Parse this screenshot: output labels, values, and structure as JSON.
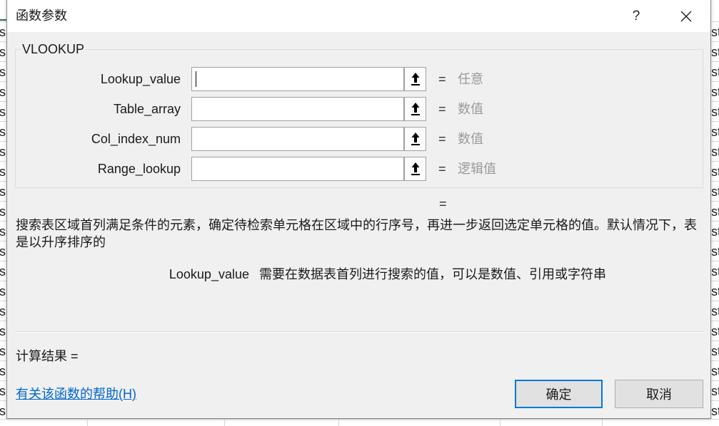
{
  "dialog": {
    "title": "函数参数",
    "help_label": "?",
    "function_name": "VLOOKUP",
    "arguments": [
      {
        "label": "Lookup_value",
        "value": "",
        "equals": "=",
        "result": "任意"
      },
      {
        "label": "Table_array",
        "value": "",
        "equals": "=",
        "result": "数值"
      },
      {
        "label": "Col_index_num",
        "value": "",
        "equals": "=",
        "result": "数值"
      },
      {
        "label": "Range_lookup",
        "value": "",
        "equals": "=",
        "result": "逻辑值"
      }
    ],
    "function_result_equals": "=",
    "description": "搜索表区域首列满足条件的元素，确定待检索单元格在区域中的行序号，再进一步返回选定单元格的值。默认情况下，表是以升序排序的",
    "current_argument": {
      "name": "Lookup_value",
      "description": "需要在数据表首列进行搜索的值，可以是数值、引用或字符串"
    },
    "result_label": "计算结果 =",
    "help_link": "有关该函数的帮助(H)",
    "ok_label": "确定",
    "cancel_label": "取消"
  },
  "background": {
    "left_cell_text": "s",
    "right_cell_text": "st"
  },
  "icons": {
    "help": "question-mark-icon",
    "close": "close-icon",
    "collapse_dialog": "collapse-dialog-icon"
  },
  "colors": {
    "link": "#0066cc",
    "default_button_border": "#0078d7",
    "hint_text": "#9a9a9a",
    "dialog_background": "#f0f0f0",
    "selection_green": "#217346"
  }
}
